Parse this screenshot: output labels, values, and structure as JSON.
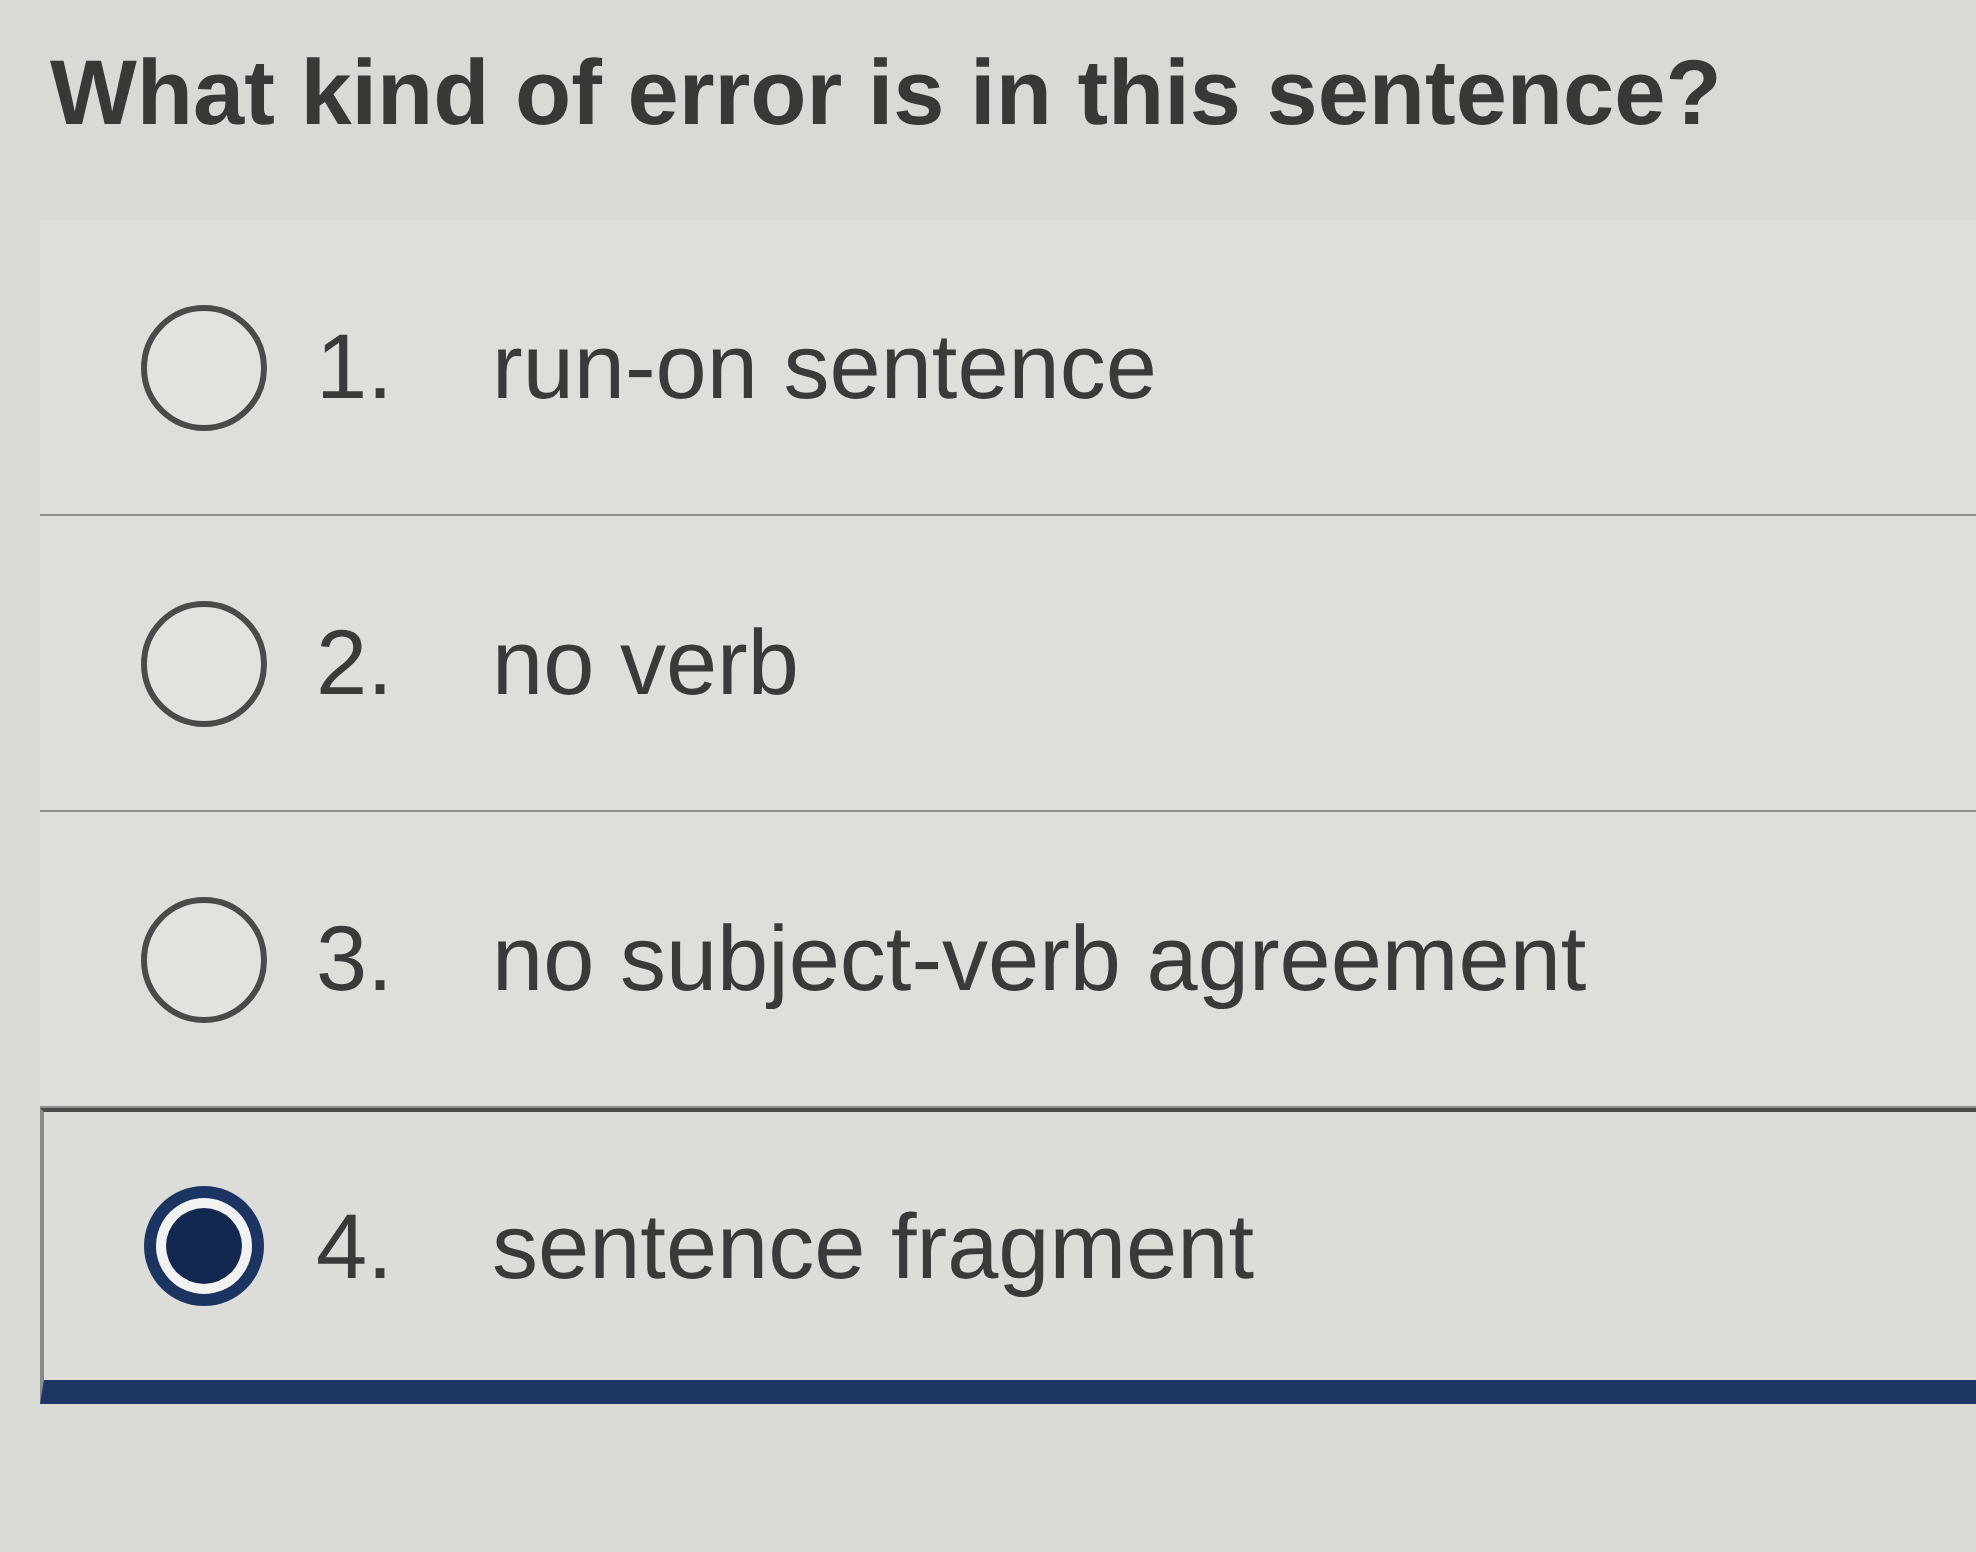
{
  "question": "What kind of error is in this sentence?",
  "options": [
    {
      "number": "1.",
      "label": "run-on sentence",
      "selected": false
    },
    {
      "number": "2.",
      "label": "no verb",
      "selected": false
    },
    {
      "number": "3.",
      "label": "no subject-verb agreement",
      "selected": false
    },
    {
      "number": "4.",
      "label": "sentence fragment",
      "selected": true
    }
  ]
}
